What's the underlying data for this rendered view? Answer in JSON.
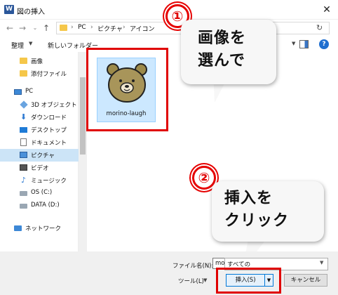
{
  "window": {
    "title": "図の挿入",
    "app_icon": "W"
  },
  "address": {
    "crumbs": [
      "PC",
      "ピクチャ",
      "アイコン"
    ],
    "separator": "›"
  },
  "toolbar": {
    "organize_label": "整理",
    "new_folder_label": "新しいフォルダー",
    "help": "?"
  },
  "sidebar": {
    "items": [
      {
        "label": "画像",
        "icon": "folder-icon"
      },
      {
        "label": "添付ファイル",
        "icon": "folder-icon"
      },
      {
        "label": "PC",
        "icon": "pc-icon"
      },
      {
        "label": "3D オブジェクト",
        "icon": "3d-objects-icon"
      },
      {
        "label": "ダウンロード",
        "icon": "download-icon"
      },
      {
        "label": "デスクトップ",
        "icon": "desktop-icon"
      },
      {
        "label": "ドキュメント",
        "icon": "document-icon"
      },
      {
        "label": "ピクチャ",
        "icon": "pictures-icon",
        "selected": true
      },
      {
        "label": "ビデオ",
        "icon": "video-icon"
      },
      {
        "label": "ミュージック",
        "icon": "music-icon"
      },
      {
        "label": "OS (C:)",
        "icon": "drive-icon"
      },
      {
        "label": "DATA (D:)",
        "icon": "drive-icon"
      },
      {
        "label": "ネットワーク",
        "icon": "network-icon"
      }
    ]
  },
  "files": [
    {
      "name": "morino-laugh"
    }
  ],
  "callouts": {
    "step1": {
      "badge": "①",
      "line1": "画像を",
      "line2": "選んで"
    },
    "step2": {
      "badge": "②",
      "line1": "挿入を",
      "line2": "クリック"
    }
  },
  "footer": {
    "filename_label": "ファイル名(N):",
    "filename_value": "morino-laugh",
    "filetype_value": "すべての",
    "tools_label": "ツール(L)",
    "insert_label": "挿入(S)",
    "cancel_label": "キャンセル"
  },
  "colors": {
    "highlight": "#e00000",
    "selection": "#cce8ff",
    "accent": "#0078d7"
  }
}
